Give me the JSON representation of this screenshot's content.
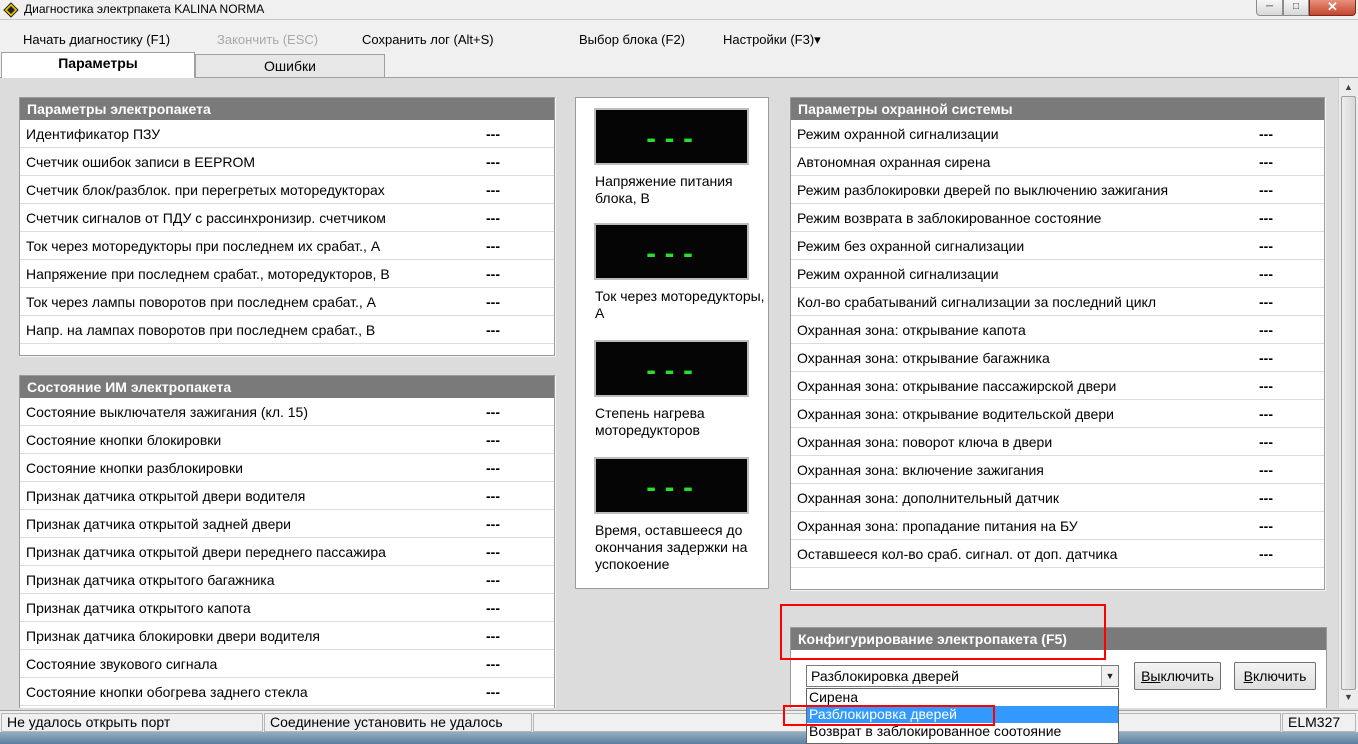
{
  "window": {
    "title": "Диагностика электрпакета KALINA NORMA",
    "minimize_glyph": "─",
    "maximize_glyph": "□",
    "close_glyph": "✕"
  },
  "menu": {
    "start": "Начать диагностику (F1)",
    "finish": "Закончить (ESC)",
    "save_log": "Сохранить лог (Alt+S)",
    "select_block": "Выбор блока (F2)",
    "settings": "Настройки (F3)▾"
  },
  "tabs": [
    {
      "label": "Параметры"
    },
    {
      "label": "Ошибки"
    }
  ],
  "electro_params": {
    "title": "Параметры электропакета",
    "rows": [
      {
        "label": "Идентификатор ПЗУ",
        "value": "---"
      },
      {
        "label": "Счетчик ошибок записи в EEPROM",
        "value": "---"
      },
      {
        "label": "Счетчик блок/разблок. при перегретых моторедукторах",
        "value": "---"
      },
      {
        "label": "Счетчик сигналов от ПДУ с рассинхронизир. счетчиком",
        "value": "---"
      },
      {
        "label": "Ток через моторедукторы при последнем их срабат., А",
        "value": "---"
      },
      {
        "label": "Напряжение при последнем срабат., моторедукторов, В",
        "value": "---"
      },
      {
        "label": "Ток через лампы поворотов при последнем срабат., А",
        "value": "---"
      },
      {
        "label": "Напр. на лампах поворотов при последнем срабат., В",
        "value": "---"
      }
    ]
  },
  "im_state": {
    "title": "Состояние ИМ электропакета",
    "rows": [
      {
        "label": "Состояние выключателя зажигания (кл. 15)",
        "value": "---"
      },
      {
        "label": "Состояние кнопки блокировки",
        "value": "---"
      },
      {
        "label": "Состояние кнопки разблокировки",
        "value": "---"
      },
      {
        "label": "Признак датчика открытой двери водителя",
        "value": "---"
      },
      {
        "label": "Признак датчика открытой задней двери",
        "value": "---"
      },
      {
        "label": "Признак датчика открытой двери переднего пассажира",
        "value": "---"
      },
      {
        "label": "Признак датчика открытого багажника",
        "value": "---"
      },
      {
        "label": "Признак датчика открытого капота",
        "value": "---"
      },
      {
        "label": "Признак датчика блокировки двери водителя",
        "value": "---"
      },
      {
        "label": "Состояние звукового сигнала",
        "value": "---"
      },
      {
        "label": "Состояние кнопки обогрева заднего стекла",
        "value": "---"
      }
    ]
  },
  "gauges": [
    {
      "display": "---",
      "label": "Напряжение питания блока, В"
    },
    {
      "display": "---",
      "label": "Ток через моторедукторы, А"
    },
    {
      "display": "---",
      "label": "Степень нагрева моторедукторов"
    },
    {
      "display": "---",
      "label": "Время, оставшееся до окончания задержки на успокоение"
    }
  ],
  "security_params": {
    "title": "Параметры охранной системы",
    "rows": [
      {
        "label": "Режим охранной сигнализации",
        "value": "---"
      },
      {
        "label": "Автономная охранная сирена",
        "value": "---"
      },
      {
        "label": "Режим разблокировки дверей по выключению зажигания",
        "value": "---"
      },
      {
        "label": "Режим возврата в заблокированное состояние",
        "value": "---"
      },
      {
        "label": "Режим без охранной сигнализации",
        "value": "---"
      },
      {
        "label": "Режим охранной сигнализации",
        "value": "---"
      },
      {
        "label": "Кол-во срабатываний сигнализации за последний цикл",
        "value": "---"
      },
      {
        "label": "Охранная зона: открывание капота",
        "value": "---"
      },
      {
        "label": "Охранная зона: открывание багажника",
        "value": "---"
      },
      {
        "label": "Охранная зона: открывание пассажирской двери",
        "value": "---"
      },
      {
        "label": "Охранная зона: открывание водительской двери",
        "value": "---"
      },
      {
        "label": "Охранная зона: поворот ключа в двери",
        "value": "---"
      },
      {
        "label": "Охранная зона: включение зажигания",
        "value": "---"
      },
      {
        "label": "Охранная зона: дополнительный датчик",
        "value": "---"
      },
      {
        "label": "Охранная зона: пропадание питания на БУ",
        "value": "---"
      },
      {
        "label": "Оставшееся кол-во сраб. сигнал. от доп. датчика",
        "value": "---"
      }
    ]
  },
  "config": {
    "title": "Конфигурирование электропакета (F5)",
    "selected": "Разблокировка дверей",
    "disable_accel": "Вы",
    "disable_rest": "ключить",
    "enable_accel": "В",
    "enable_rest": "ключить",
    "options": [
      "Сирена",
      "Разблокировка дверей",
      "Возврат в заблокированное соотояние"
    ]
  },
  "status": {
    "port": "Не удалось открыть порт",
    "connection": "Соединение установить не удалось",
    "adapter": "ELM327"
  },
  "scrollbar": {
    "up": "▲",
    "down": "▼"
  },
  "accent_colors": {
    "header_bg": "#7a7a7a",
    "led": "#27e02c",
    "highlight": "#ff0000",
    "selection": "#3399ff"
  }
}
